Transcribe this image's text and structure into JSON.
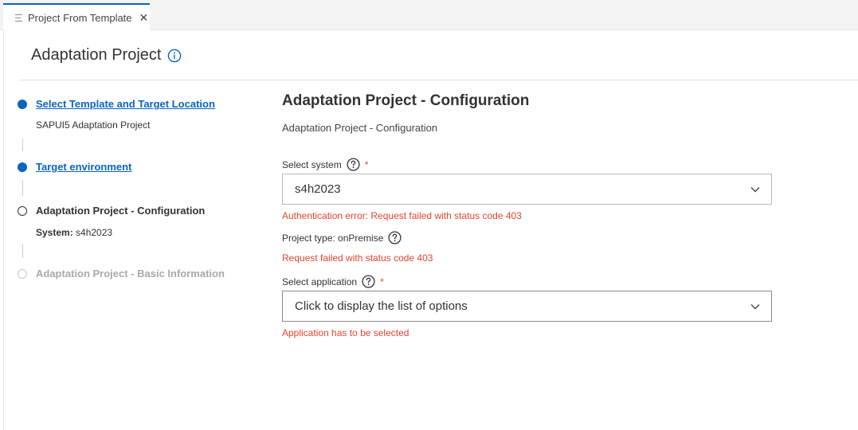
{
  "tab": {
    "label": "Project From Template",
    "close_glyph": "✕",
    "menu_icon": "menu-lines-icon"
  },
  "header": {
    "title": "Adaptation Project",
    "info_icon": "info-icon"
  },
  "colors": {
    "accent": "#0a64c0",
    "error": "#e0452e",
    "disabled": "#a9a9a9"
  },
  "steps": [
    {
      "label": "Select Template and Target Location",
      "state": "completed",
      "detail": "SAPUI5 Adaptation Project"
    },
    {
      "label": "Target environment",
      "state": "completed"
    },
    {
      "label": "Adaptation Project - Configuration",
      "state": "current",
      "detail_label": "System:",
      "detail_value": "s4h2023"
    },
    {
      "label": "Adaptation Project - Basic Information",
      "state": "disabled"
    }
  ],
  "form": {
    "title": "Adaptation Project - Configuration",
    "subtitle": "Adaptation Project - Configuration",
    "system": {
      "label": "Select system",
      "required_mark": "*",
      "value": "s4h2023",
      "error": "Authentication error: Request failed with status code 403"
    },
    "project_type": {
      "label": "Project type: onPremise",
      "error": "Request failed with status code 403"
    },
    "application": {
      "label": "Select application",
      "required_mark": "*",
      "placeholder": "Click to display the list of options",
      "error": "Application has to be selected"
    }
  }
}
